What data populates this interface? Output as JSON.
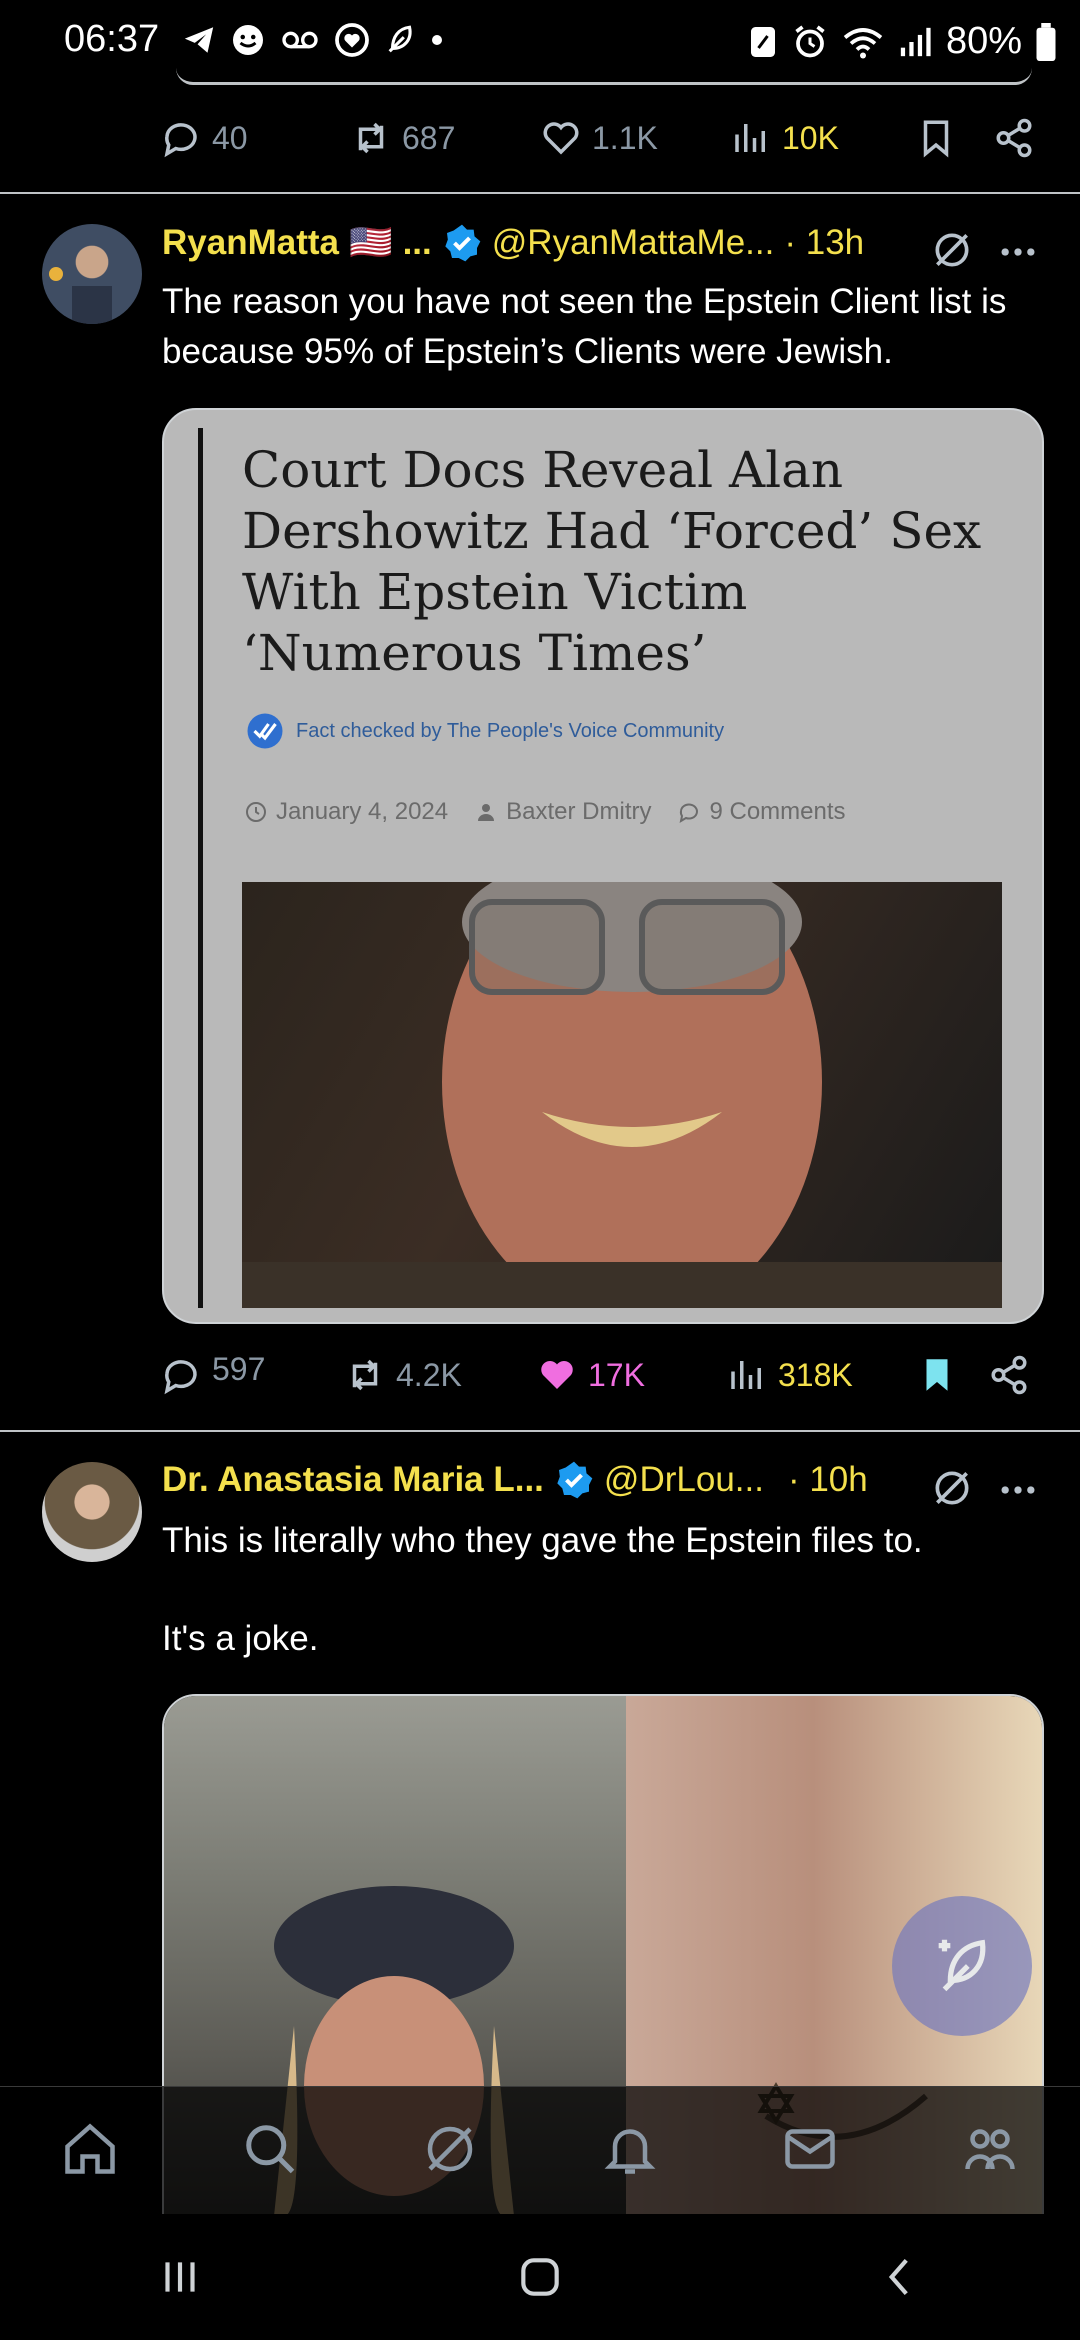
{
  "status_bar": {
    "time": "06:37",
    "battery_percent": "80%"
  },
  "prev_tweet_actions": {
    "replies": "40",
    "reposts": "687",
    "likes": "1.1K",
    "views": "10K"
  },
  "tweet1": {
    "author_name": "RyanMatta",
    "flag": "🇺🇸",
    "ellipsis": "...",
    "handle": "@RyanMattaMe...",
    "time": "· 13h",
    "text": "The reason you have not seen the Epstein Client list is because 95% of Epstein’s Clients were Jewish.",
    "card": {
      "headline": "Court Docs Reveal Alan Dershowitz Had ‘Forced’ Sex With Epstein Victim ‘Numerous Times’",
      "fact_check": "Fact checked by The People's Voice Community",
      "date": "January 4, 2024",
      "author": "Baxter Dmitry",
      "comments": "9 Comments"
    },
    "actions": {
      "replies": "597",
      "reposts": "4.2K",
      "likes": "17K",
      "views": "318K"
    }
  },
  "tweet2": {
    "author_name": "Dr. Anastasia Maria L...",
    "handle": "@DrLou...",
    "time": "· 10h",
    "text_line1": "This is literally who they gave the Epstein files to.",
    "text_line2": "It's a joke."
  },
  "colors": {
    "accent_yellow": "#f4e04d",
    "like_pink": "#f06ee0",
    "bookmark_cyan": "#7de3ef",
    "verified_blue": "#1d9bf0"
  }
}
